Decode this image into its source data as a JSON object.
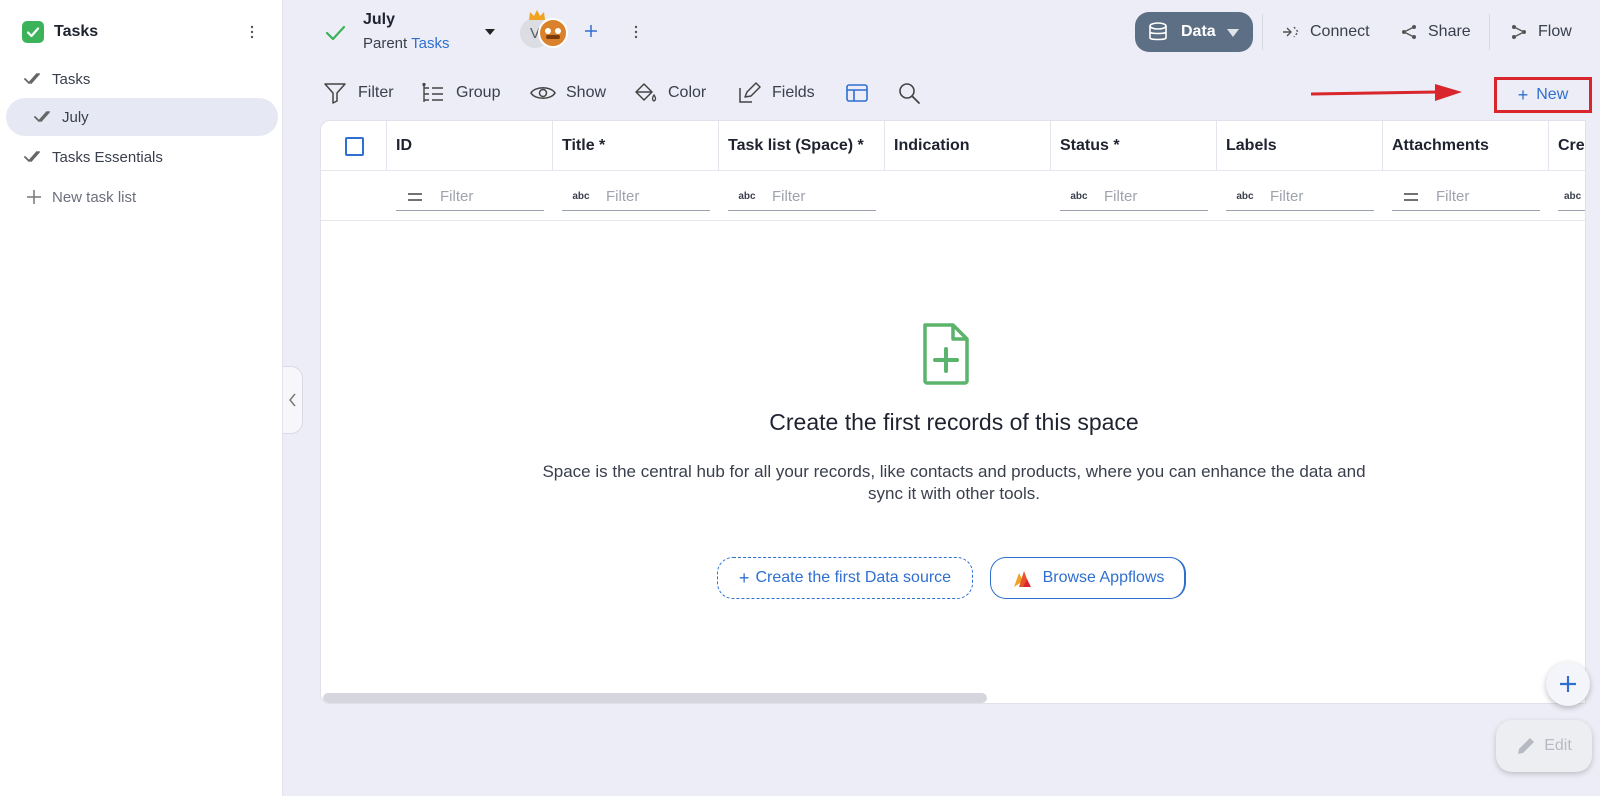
{
  "sidebar": {
    "app_title": "Tasks",
    "items": [
      {
        "label": "Tasks",
        "icon": "double-check-icon"
      },
      {
        "label": "July",
        "icon": "double-check-icon",
        "active": true
      },
      {
        "label": "Tasks Essentials",
        "icon": "double-check-icon"
      },
      {
        "label": "New task list",
        "icon": "plus-icon"
      }
    ]
  },
  "header": {
    "view_name": "July",
    "parent_prefix": "Parent",
    "parent_link": "Tasks",
    "avatar_initial": "V",
    "data_label": "Data",
    "connect_label": "Connect",
    "share_label": "Share",
    "flow_label": "Flow"
  },
  "toolbar": {
    "filter_label": "Filter",
    "group_label": "Group",
    "show_label": "Show",
    "color_label": "Color",
    "fields_label": "Fields",
    "new_label": "New"
  },
  "table": {
    "columns": [
      {
        "label": "ID",
        "filter_icon": "equals"
      },
      {
        "label": "Title *",
        "filter_icon": "abc"
      },
      {
        "label": "Task list (Space) *",
        "filter_icon": "abc"
      },
      {
        "label": "Indication",
        "filter_icon": "none"
      },
      {
        "label": "Status *",
        "filter_icon": "abc"
      },
      {
        "label": "Labels",
        "filter_icon": "abc"
      },
      {
        "label": "Attachments",
        "filter_icon": "equals"
      },
      {
        "label": "Crea",
        "filter_icon": "abc"
      }
    ],
    "filter_placeholder": "Filter"
  },
  "empty_state": {
    "title": "Create the first records of this space",
    "description": "Space is the central hub for all your records, like contacts and products, where you can enhance the data and sync it with other tools.",
    "create_button": "Create the first Data source",
    "browse_button": "Browse Appflows"
  },
  "fab": {
    "edit_label": "Edit"
  },
  "colors": {
    "accent": "#2f6fd0",
    "brand_green": "#3cb35a",
    "annotation_red": "#d9262c",
    "data_pill": "#5d6f85"
  }
}
